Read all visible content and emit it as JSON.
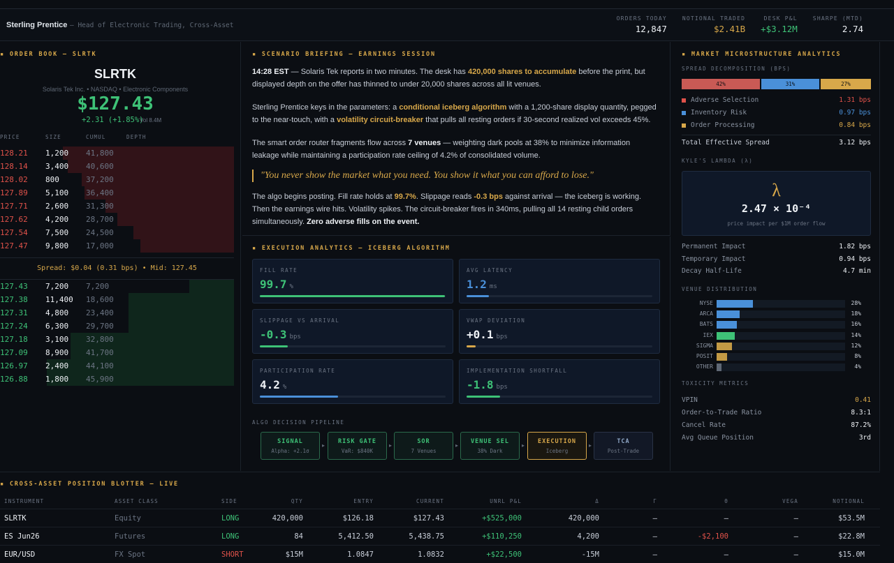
{
  "header": {
    "name": "Sterling Prentice",
    "role": "— Head of Electronic Trading, Cross-Asset",
    "kpis": [
      {
        "label": "ORDERS TODAY",
        "value": "12,847",
        "color": "#eef1f5"
      },
      {
        "label": "NOTIONAL TRADED",
        "value": "$2.41B",
        "color": "#d8a84a"
      },
      {
        "label": "DESK P&L",
        "value": "+$3.12M",
        "color": "#3ec277"
      },
      {
        "label": "SHARPE (MTD)",
        "value": "2.74",
        "color": "#eef1f5"
      }
    ]
  },
  "orderbook": {
    "title": "ORDER BOOK — SLRTK",
    "symbol": "SLRTK",
    "company": "Solaris Tek Inc. • NASDAQ • Electronic Components",
    "price": "$127.43",
    "change": "+2.31 (+1.85%)",
    "volume": "Vol 8.4M",
    "columns": [
      "PRICE",
      "SIZE",
      "CUMUL",
      "DEPTH"
    ],
    "asks": [
      {
        "price": "128.21",
        "size": "1,200",
        "cumul": "41,800",
        "depth": 0.73
      },
      {
        "price": "128.14",
        "size": "3,400",
        "cumul": "40,600",
        "depth": 0.71
      },
      {
        "price": "128.02",
        "size": "800",
        "cumul": "37,200",
        "depth": 0.65
      },
      {
        "price": "127.89",
        "size": "5,100",
        "cumul": "36,400",
        "depth": 0.64
      },
      {
        "price": "127.71",
        "size": "2,600",
        "cumul": "31,300",
        "depth": 0.55
      },
      {
        "price": "127.62",
        "size": "4,200",
        "cumul": "28,700",
        "depth": 0.5
      },
      {
        "price": "127.54",
        "size": "7,500",
        "cumul": "24,500",
        "depth": 0.43
      },
      {
        "price": "127.47",
        "size": "9,800",
        "cumul": "17,000",
        "depth": 0.4
      }
    ],
    "spread": "Spread: $0.04  (0.31 bps)  •  Mid: 127.45",
    "bids": [
      {
        "price": "127.43",
        "size": "7,200",
        "cumul": "7,200",
        "depth": 0.19
      },
      {
        "price": "127.38",
        "size": "11,400",
        "cumul": "18,600",
        "depth": 0.45
      },
      {
        "price": "127.31",
        "size": "4,800",
        "cumul": "23,400",
        "depth": 0.45
      },
      {
        "price": "127.24",
        "size": "6,300",
        "cumul": "29,700",
        "depth": 0.45
      },
      {
        "price": "127.18",
        "size": "3,100",
        "cumul": "32,800",
        "depth": 0.7
      },
      {
        "price": "127.09",
        "size": "8,900",
        "cumul": "41,700",
        "depth": 0.7
      },
      {
        "price": "126.97",
        "size": "2,400",
        "cumul": "44,100",
        "depth": 0.8
      },
      {
        "price": "126.88",
        "size": "1,800",
        "cumul": "45,900",
        "depth": 0.8
      }
    ]
  },
  "briefing": {
    "title": "SCENARIO BRIEFING — EARNINGS SESSION",
    "p1": {
      "time": "14:28 EST",
      "a": " — Solaris Tek reports in two minutes. The desk has ",
      "h1": "420,000 shares to accumulate",
      "b": " before the print, but displayed depth on the offer has thinned to under 20,000 shares across all lit venues."
    },
    "p2": {
      "a": "Sterling Prentice keys in the parameters: a ",
      "h1": "conditional iceberg algorithm",
      "b": " with a 1,200-share display quantity, pegged to the near-touch, with a ",
      "h2": "volatility circuit-breaker",
      "c": " that pulls all resting orders if 30-second realized vol exceeds 45%."
    },
    "p3": {
      "a": "The smart order router fragments flow across ",
      "b1": "7 venues",
      "b": " — weighting dark pools at 38% to minimize information leakage while maintaining a participation rate ceiling of 4.2% of consolidated volume."
    },
    "quote": "\"You never show the market what you need. You show it what you can afford to lose.\"",
    "p4": {
      "a": "The algo begins posting. Fill rate holds at ",
      "h1": "99.7%",
      "b": ". Slippage reads ",
      "h2": "-0.3 bps",
      "c": " against arrival — the iceberg is working. Then the earnings wire hits. Volatility spikes. The circuit-breaker fires in 340ms, pulling all 14 resting child orders simultaneously. ",
      "b1": "Zero adverse fills on the event."
    }
  },
  "execution": {
    "title": "EXECUTION ANALYTICS — ICEBERG ALGORITHM",
    "cards": [
      {
        "label": "FILL RATE",
        "value": "99.7",
        "unit": "%",
        "color": "#3ec277",
        "fill": 0.997
      },
      {
        "label": "AVG LATENCY",
        "value": "1.2",
        "unit": "ms",
        "color": "#4a90d9",
        "fill": 0.12
      },
      {
        "label": "SLIPPAGE VS ARRIVAL",
        "value": "-0.3",
        "unit": "bps",
        "color": "#3ec277",
        "fill": 0.15
      },
      {
        "label": "VWAP DEVIATION",
        "value": "+0.1",
        "unit": "bps",
        "color": "#eef1f5",
        "fill": 0.05
      },
      {
        "label": "PARTICIPATION RATE",
        "value": "4.2",
        "unit": "%",
        "color": "#eef1f5",
        "fill": 0.42
      },
      {
        "label": "IMPLEMENTATION SHORTFALL",
        "value": "-1.8",
        "unit": "bps",
        "color": "#3ec277",
        "fill": 0.18
      }
    ],
    "pipeline_label": "ALGO DECISION PIPELINE",
    "pipeline": [
      {
        "title": "SIGNAL",
        "sub": "Alpha: +2.1σ"
      },
      {
        "title": "RISK GATE",
        "sub": "VaR: $840K"
      },
      {
        "title": "SOR",
        "sub": "7 Venues"
      },
      {
        "title": "VENUE SEL",
        "sub": "38% Dark"
      },
      {
        "title": "EXECUTION",
        "sub": "Iceberg"
      },
      {
        "title": "TCA",
        "sub": "Post-Trade"
      }
    ]
  },
  "micro": {
    "title": "MARKET MICROSTRUCTURE ANALYTICS",
    "spread_label": "SPREAD DECOMPOSITION (BPS)",
    "spread": [
      {
        "pct": "42%",
        "share": 0.42,
        "color": "#c95a55"
      },
      {
        "pct": "31%",
        "share": 0.31,
        "color": "#4a90d9"
      },
      {
        "pct": "27%",
        "share": 0.27,
        "color": "#d8a84a"
      }
    ],
    "components": [
      {
        "name": "Adverse Selection",
        "value": "1.31 bps",
        "color": "#e0524a"
      },
      {
        "name": "Inventory Risk",
        "value": "0.97 bps",
        "color": "#4a90d9"
      },
      {
        "name": "Order Processing",
        "value": "0.84 bps",
        "color": "#d8a84a"
      }
    ],
    "total": {
      "name": "Total Effective Spread",
      "value": "3.12 bps"
    },
    "kyle_label": "KYLE'S LAMBDA (λ)",
    "kyle_symbol": "λ",
    "kyle_value": "2.47 × 10⁻⁴",
    "kyle_desc": "price impact per $1M order flow",
    "impact": [
      {
        "name": "Permanent Impact",
        "value": "1.82 bps"
      },
      {
        "name": "Temporary Impact",
        "value": "0.94 bps"
      },
      {
        "name": "Decay Half-Life",
        "value": "4.7 min"
      }
    ],
    "venue_label": "VENUE DISTRIBUTION",
    "venues": [
      {
        "name": "NYSE",
        "pct": "28%",
        "share": 0.28,
        "color": "#4a90d9"
      },
      {
        "name": "ARCA",
        "pct": "18%",
        "share": 0.18,
        "color": "#4a90d9"
      },
      {
        "name": "BATS",
        "pct": "16%",
        "share": 0.16,
        "color": "#4a90d9"
      },
      {
        "name": "IEX",
        "pct": "14%",
        "share": 0.14,
        "color": "#3ec277"
      },
      {
        "name": "SIGMA",
        "pct": "12%",
        "share": 0.12,
        "color": "#c39a45"
      },
      {
        "name": "POSIT",
        "pct": "8%",
        "share": 0.08,
        "color": "#c39a45"
      },
      {
        "name": "OTHER",
        "pct": "4%",
        "share": 0.04,
        "color": "#5f6875"
      }
    ],
    "toxicity_label": "TOXICITY METRICS",
    "toxicity": [
      {
        "name": "VPIN",
        "value": "0.41",
        "color": "#d8a84a"
      },
      {
        "name": "Order-to-Trade Ratio",
        "value": "8.3:1",
        "color": "#eef1f5"
      },
      {
        "name": "Cancel Rate",
        "value": "87.2%",
        "color": "#eef1f5"
      },
      {
        "name": "Avg Queue Position",
        "value": "3rd",
        "color": "#eef1f5"
      }
    ]
  },
  "blotter": {
    "title": "CROSS-ASSET POSITION BLOTTER — LIVE",
    "columns": [
      "INSTRUMENT",
      "ASSET CLASS",
      "SIDE",
      "QTY",
      "ENTRY",
      "CURRENT",
      "UNRL P&L",
      "Δ",
      "Γ",
      "Θ",
      "VEGA",
      "NOTIONAL"
    ],
    "rows": [
      [
        "SLRTK",
        "Equity",
        "LONG",
        "420,000",
        "$126.18",
        "$127.43",
        "+$525,000",
        "420,000",
        "—",
        "—",
        "—",
        "$53.5M"
      ],
      [
        "ES Jun26",
        "Futures",
        "LONG",
        "84",
        "5,412.50",
        "5,438.75",
        "+$110,250",
        "4,200",
        "—",
        "-$2,100",
        "—",
        "$22.8M"
      ],
      [
        "EUR/USD",
        "FX Spot",
        "SHORT",
        "$15M",
        "1.0847",
        "1.0832",
        "+$22,500",
        "-15M",
        "—",
        "—",
        "—",
        "$15.0M"
      ]
    ]
  }
}
